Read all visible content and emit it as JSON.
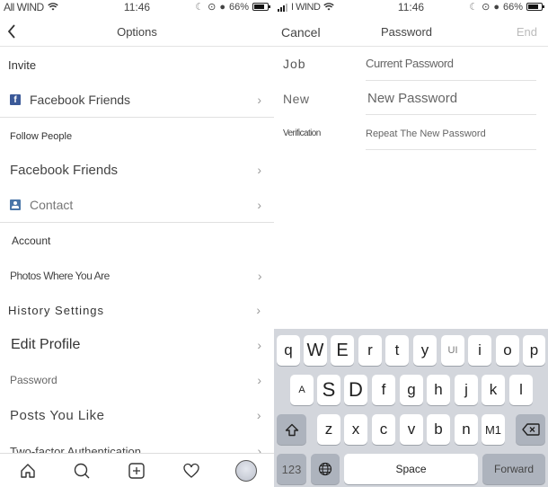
{
  "left": {
    "status": {
      "carrier": "All WIND",
      "time": "11:46",
      "battery": "66%",
      "battery_level": 0.66
    },
    "nav": {
      "title": "Options",
      "back_icon": "chevron-left-icon"
    },
    "sections": [
      {
        "header": "Invite",
        "items": [
          {
            "label": "Facebook Friends",
            "icon": "facebook-icon"
          }
        ]
      },
      {
        "header": "Follow People",
        "items": [
          {
            "label": "Facebook Friends"
          },
          {
            "label": "Contact",
            "icon": "contact-icon"
          }
        ]
      },
      {
        "header": "Account",
        "items": [
          {
            "label": "Photos Where You Are"
          },
          {
            "label": "History Settings"
          },
          {
            "label": "Edit Profile"
          },
          {
            "label": "Password"
          },
          {
            "label": "Posts You Like"
          },
          {
            "label": "Two-factor Authentication"
          }
        ]
      }
    ],
    "chevron": "›",
    "tabbar": [
      "home-icon",
      "search-icon",
      "add-post-icon",
      "heart-icon",
      "profile-avatar"
    ]
  },
  "right": {
    "status": {
      "carrier": "I WIND",
      "time": "11:46",
      "battery": "66%",
      "battery_level": 0.66
    },
    "nav": {
      "cancel": "Cancel",
      "title": "Password",
      "end": "End"
    },
    "fields": [
      {
        "label": "Job",
        "placeholder": "Current Password"
      },
      {
        "label": "New",
        "placeholder": "New Password"
      },
      {
        "label": "Verification",
        "placeholder": "Repeat The New Password"
      }
    ],
    "keyboard": {
      "row1": [
        "q",
        "W",
        "E",
        "r",
        "t",
        "y",
        "UI",
        "i",
        "o",
        "p"
      ],
      "row2": [
        "A",
        "S",
        "D",
        "f",
        "g",
        "h",
        "j",
        "k",
        "l"
      ],
      "row3": [
        "z",
        "x",
        "c",
        "v",
        "b",
        "n",
        "M1"
      ],
      "shift_icon": "shift-icon",
      "backspace_icon": "backspace-icon",
      "numbers": "123",
      "globe_icon": "globe-icon",
      "space": "Space",
      "return": "Forward"
    }
  }
}
